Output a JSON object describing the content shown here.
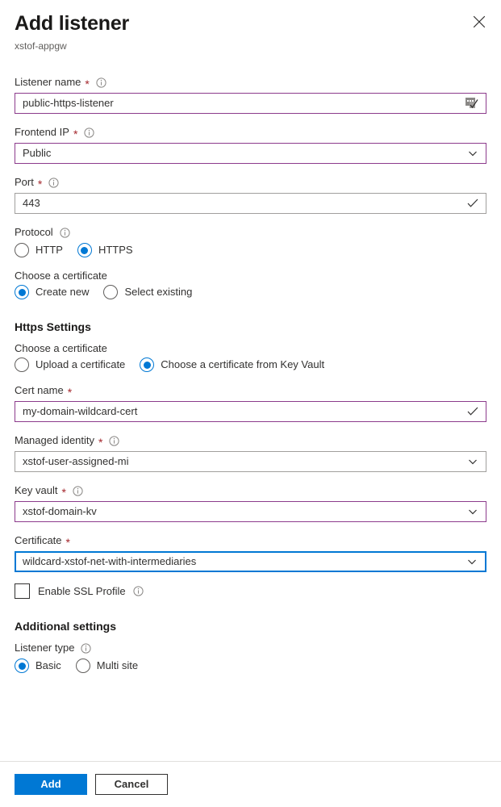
{
  "blade": {
    "title": "Add listener",
    "subtitle": "xstof-appgw",
    "close_icon": "close-icon"
  },
  "fields": {
    "listener_name": {
      "label": "Listener name",
      "required": true,
      "has_info": true,
      "value": "public-https-listener",
      "trailing_icon": "ime-indicator-icon"
    },
    "frontend_ip": {
      "label": "Frontend IP",
      "required": true,
      "has_info": true,
      "value": "Public",
      "trailing_icon": "chevron-down-icon"
    },
    "port": {
      "label": "Port",
      "required": true,
      "has_info": true,
      "value": "443",
      "trailing_icon": "checkmark-icon"
    },
    "protocol": {
      "label": "Protocol",
      "has_info": true,
      "options": [
        "HTTP",
        "HTTPS"
      ],
      "selected": "HTTPS"
    },
    "choose_certificate_top": {
      "label": "Choose a certificate",
      "options": [
        "Create new",
        "Select existing"
      ],
      "selected": "Create new"
    },
    "choose_certificate_https": {
      "label": "Choose a certificate",
      "options": [
        "Upload a certificate",
        "Choose a certificate from Key Vault"
      ],
      "selected": "Choose a certificate from Key Vault"
    },
    "cert_name": {
      "label": "Cert name",
      "required": true,
      "has_info": false,
      "value": "my-domain-wildcard-cert",
      "trailing_icon": "checkmark-icon"
    },
    "managed_identity": {
      "label": "Managed identity",
      "required": true,
      "has_info": true,
      "value": "xstof-user-assigned-mi",
      "trailing_icon": "chevron-down-icon"
    },
    "key_vault": {
      "label": "Key vault",
      "required": true,
      "has_info": true,
      "value": "xstof-domain-kv",
      "trailing_icon": "chevron-down-icon"
    },
    "certificate": {
      "label": "Certificate",
      "required": true,
      "has_info": false,
      "value": "wildcard-xstof-net-with-intermediaries",
      "trailing_icon": "chevron-down-icon"
    },
    "enable_ssl_profile": {
      "label": "Enable SSL Profile",
      "checked": false,
      "has_info": true
    },
    "listener_type": {
      "label": "Listener type",
      "has_info": true,
      "options": [
        "Basic",
        "Multi site"
      ],
      "selected": "Basic"
    }
  },
  "sections": {
    "https_settings": "Https Settings",
    "additional_settings": "Additional settings"
  },
  "footer": {
    "add_label": "Add",
    "cancel_label": "Cancel"
  },
  "colors": {
    "accent": "#0078d4",
    "required_asterisk": "#a4262c",
    "visited_border": "#8c3b8c",
    "default_border": "#a19f9d"
  }
}
